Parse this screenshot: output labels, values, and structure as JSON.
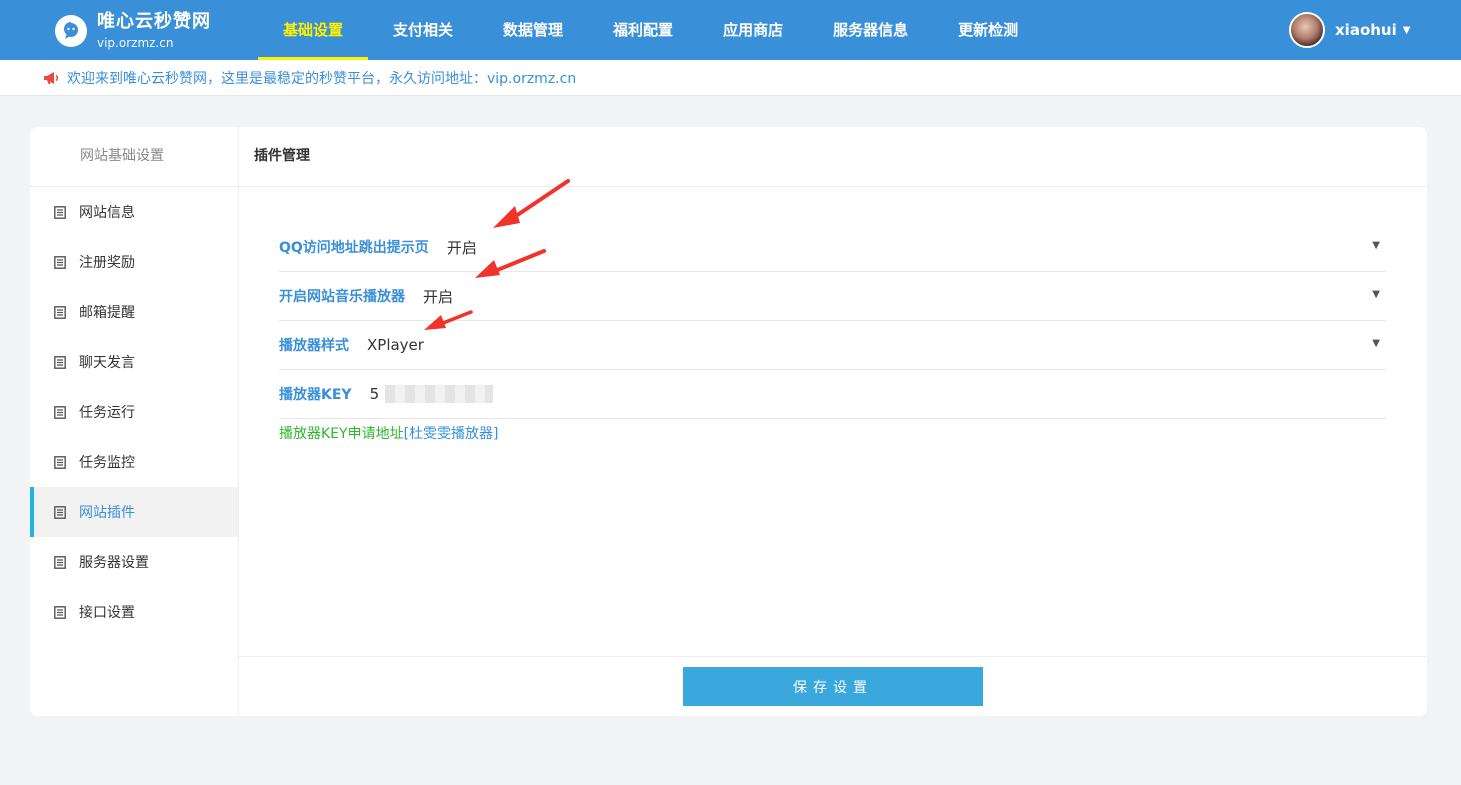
{
  "brand": {
    "title": "唯心云秒赞网",
    "subtitle": "vip.orzmz.cn"
  },
  "nav": [
    {
      "label": "基础设置",
      "active": true
    },
    {
      "label": "支付相关"
    },
    {
      "label": "数据管理"
    },
    {
      "label": "福利配置"
    },
    {
      "label": "应用商店"
    },
    {
      "label": "服务器信息"
    },
    {
      "label": "更新检测"
    }
  ],
  "user": {
    "name": "xiaohui"
  },
  "notice": {
    "text": "欢迎来到唯心云秒赞网，这里是最稳定的秒赞平台，永久访问地址：vip.orzmz.cn"
  },
  "sidebar": {
    "header": "网站基础设置",
    "items": [
      {
        "label": "网站信息"
      },
      {
        "label": "注册奖励"
      },
      {
        "label": "邮箱提醒"
      },
      {
        "label": "聊天发言"
      },
      {
        "label": "任务运行"
      },
      {
        "label": "任务监控"
      },
      {
        "label": "网站插件",
        "active": true
      },
      {
        "label": "服务器设置"
      },
      {
        "label": "接口设置"
      }
    ]
  },
  "main": {
    "title": "插件管理",
    "fields": [
      {
        "label": "QQ访问地址跳出提示页",
        "value": "开启"
      },
      {
        "label": "开启网站音乐播放器",
        "value": "开启"
      },
      {
        "label": "播放器样式",
        "value": "XPlayer"
      },
      {
        "label": "播放器KEY",
        "value": "5"
      }
    ],
    "key_link": {
      "prefix": "播放器KEY申请地址",
      "link": "[杜雯雯播放器]"
    },
    "save_label": "保存设置"
  },
  "colors": {
    "topbar": "#3a8fd9",
    "active_nav": "#fff200",
    "save_button": "#3aa7dd",
    "annotation_arrow": "#f0342b"
  }
}
